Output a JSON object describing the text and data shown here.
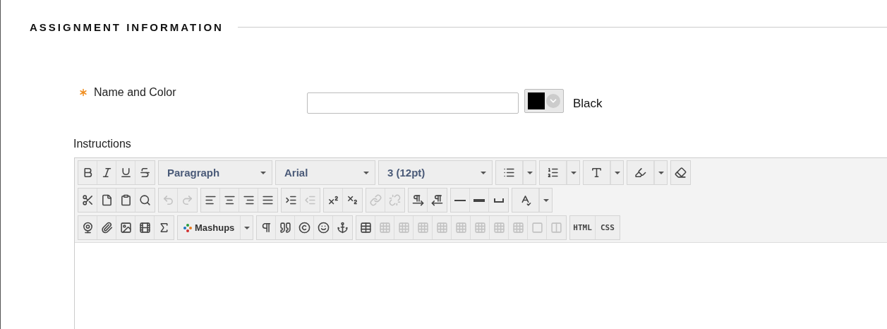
{
  "section": {
    "title": "ASSIGNMENT INFORMATION"
  },
  "name_field": {
    "label": "Name and Color",
    "required": true,
    "color_name": "Black"
  },
  "instructions": {
    "label": "Instructions",
    "toolbar": [
      [
        {
          "items": [
            {
              "kind": "icon",
              "disabled": false
            },
            {
              "kind": "icon",
              "disabled": false
            },
            {
              "kind": "icon",
              "disabled": false
            },
            {
              "kind": "icon",
              "disabled": false
            }
          ]
        },
        {
          "items": [
            {
              "kind": "select",
              "value": "Paragraph",
              "disabled": false
            }
          ]
        },
        {
          "items": [
            {
              "kind": "select",
              "value": "Arial",
              "disabled": false
            }
          ]
        },
        {
          "items": [
            {
              "kind": "select",
              "value": "3 (12pt)",
              "disabled": false
            }
          ]
        },
        {
          "items": [
            {
              "kind": "split",
              "disabled": false
            }
          ]
        },
        {
          "items": [
            {
              "kind": "split",
              "disabled": false
            }
          ]
        },
        {
          "items": [
            {
              "kind": "split",
              "disabled": false
            }
          ]
        },
        {
          "items": [
            {
              "kind": "split",
              "disabled": false
            }
          ]
        },
        {
          "items": [
            {
              "kind": "icon",
              "disabled": false
            }
          ]
        }
      ],
      [
        {
          "items": [
            {
              "kind": "icon",
              "disabled": false
            },
            {
              "kind": "icon",
              "disabled": false
            },
            {
              "kind": "icon",
              "disabled": false
            },
            {
              "kind": "icon",
              "disabled": false
            }
          ]
        },
        {
          "items": [
            {
              "kind": "icon",
              "disabled": true
            },
            {
              "kind": "icon",
              "disabled": true
            }
          ]
        },
        {
          "items": [
            {
              "kind": "icon",
              "disabled": false
            },
            {
              "kind": "icon",
              "disabled": false
            },
            {
              "kind": "icon",
              "disabled": false
            },
            {
              "kind": "icon",
              "disabled": false
            }
          ]
        },
        {
          "items": [
            {
              "kind": "icon",
              "disabled": false
            },
            {
              "kind": "icon",
              "disabled": true
            }
          ]
        },
        {
          "items": [
            {
              "kind": "icon",
              "disabled": false
            },
            {
              "kind": "icon",
              "disabled": false
            }
          ]
        },
        {
          "items": [
            {
              "kind": "icon",
              "disabled": true
            },
            {
              "kind": "icon",
              "disabled": true
            }
          ]
        },
        {
          "items": [
            {
              "kind": "icon",
              "disabled": false
            },
            {
              "kind": "icon",
              "disabled": false
            }
          ]
        },
        {
          "items": [
            {
              "kind": "icon",
              "disabled": false
            },
            {
              "kind": "icon",
              "disabled": false
            },
            {
              "kind": "icon",
              "disabled": false
            }
          ]
        },
        {
          "items": [
            {
              "kind": "split",
              "disabled": false
            }
          ]
        }
      ],
      [
        {
          "items": [
            {
              "kind": "icon",
              "disabled": false
            },
            {
              "kind": "icon",
              "disabled": false
            },
            {
              "kind": "icon",
              "disabled": false
            },
            {
              "kind": "icon",
              "disabled": false
            },
            {
              "kind": "icon",
              "disabled": false
            }
          ]
        },
        {
          "items": [
            {
              "kind": "menu",
              "value": "Mashups",
              "disabled": false
            }
          ]
        },
        {
          "items": [
            {
              "kind": "icon",
              "disabled": false
            },
            {
              "kind": "icon",
              "disabled": false
            },
            {
              "kind": "icon",
              "disabled": false
            },
            {
              "kind": "icon",
              "disabled": false
            },
            {
              "kind": "icon",
              "disabled": false
            }
          ]
        },
        {
          "items": [
            {
              "kind": "icon",
              "disabled": false
            },
            {
              "kind": "icon",
              "disabled": true
            },
            {
              "kind": "icon",
              "disabled": true
            },
            {
              "kind": "icon",
              "disabled": true
            },
            {
              "kind": "icon",
              "disabled": true
            },
            {
              "kind": "icon",
              "disabled": true
            },
            {
              "kind": "icon",
              "disabled": true
            },
            {
              "kind": "icon",
              "disabled": true
            },
            {
              "kind": "icon",
              "disabled": true
            },
            {
              "kind": "icon",
              "disabled": true
            },
            {
              "kind": "icon",
              "disabled": true
            }
          ]
        },
        {
          "items": [
            {
              "kind": "text",
              "value": "HTML",
              "disabled": false
            },
            {
              "kind": "text",
              "value": "CSS",
              "disabled": false
            }
          ]
        }
      ]
    ]
  }
}
